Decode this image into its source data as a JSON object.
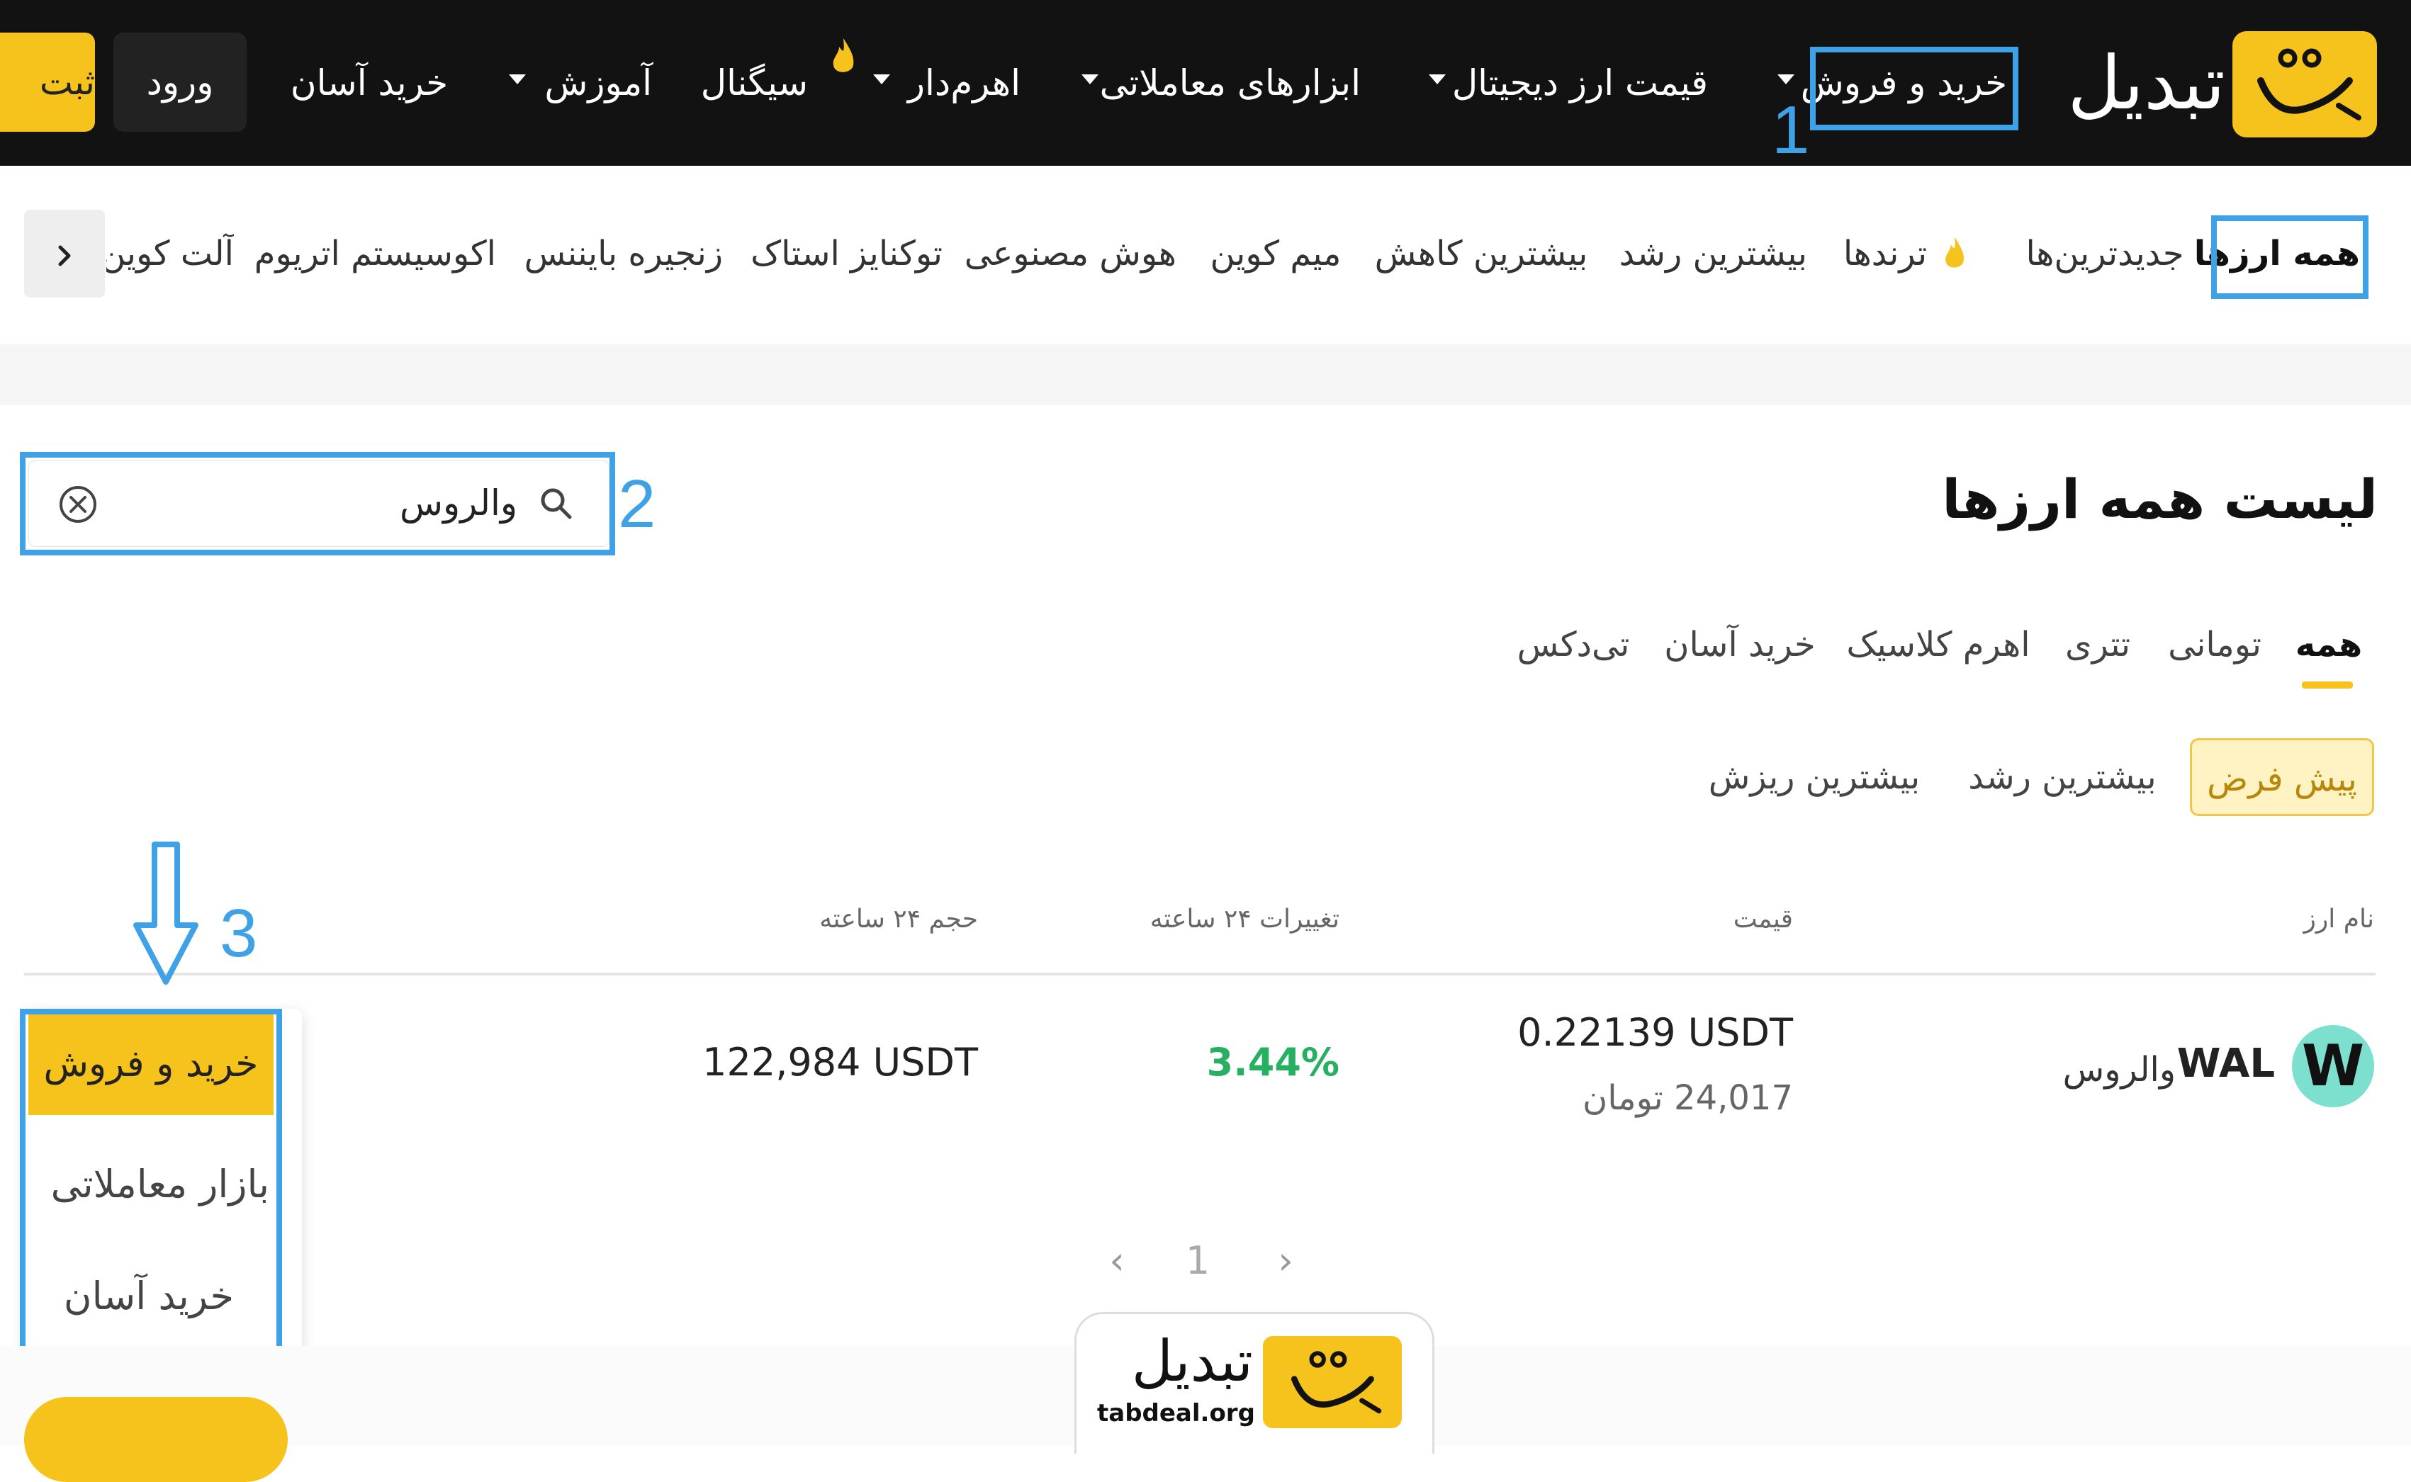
{
  "brand": {
    "name": "تبدیل",
    "accent": "#f6c21c",
    "domain": "tabdeal.org"
  },
  "nav": {
    "items": [
      "خرید و فروش",
      "قیمت ارز دیجیتال",
      "ابزارهای معاملاتی",
      "اهرم‌دار",
      "سیگنال",
      "آموزش",
      "خرید آسان"
    ],
    "login_label": "ورود",
    "register_label": "ثبت"
  },
  "categories": [
    "همه ارزها",
    "جدیدترین‌ها",
    "ترندها",
    "بیشترین رشد",
    "بیشترین کاهش",
    "میم کوین",
    "هوش مصنوعی",
    "توکنایز استاک",
    "زنجیره بایننس",
    "اکوسیستم اتریوم",
    "آلت کوین"
  ],
  "annotations": [
    "1",
    "2",
    "3"
  ],
  "main": {
    "title": "لیست همه ارزها",
    "search": {
      "value": "والروس"
    },
    "tabs": [
      "همه",
      "تومانی",
      "تتری",
      "اهرم کلاسیک",
      "خرید آسان",
      "تی‌دکس"
    ],
    "sort_chips": [
      "پیش فرض",
      "بیشترین رشد",
      "بیشترین ریزش"
    ],
    "columns": [
      "نام ارز",
      "قیمت",
      "تغییرات ۲۴ ساعته",
      "حجم ۲۴ ساعته"
    ],
    "rows": [
      {
        "icon_letter": "W",
        "symbol": "WAL",
        "name": "والروس",
        "price_usdt": "0.22139 USDT",
        "price_toman": "24,017 تومان",
        "change": "3.44%",
        "volume": "122,984 USDT"
      }
    ],
    "action_menu": [
      "خرید و فروش",
      "بازار معاملاتی",
      "خرید آسان"
    ],
    "pagination": {
      "prev": "‹",
      "page": "1",
      "next": "›"
    }
  }
}
